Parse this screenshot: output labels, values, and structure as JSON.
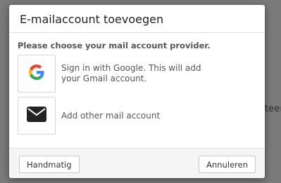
{
  "backdrop": {
    "partial_text": "teer"
  },
  "dialog": {
    "title": "E-mailaccount toevoegen",
    "prompt": "Please choose your mail account provider.",
    "options": [
      {
        "icon": "google-icon",
        "label": "Sign in with Google. This will add your Gmail account."
      },
      {
        "icon": "envelope-icon",
        "label": "Add other mail account"
      }
    ],
    "footer": {
      "manual_label": "Handmatig",
      "cancel_label": "Annuleren"
    }
  },
  "colors": {
    "backdrop": "#7a7a7a",
    "google_blue": "#4285F4",
    "google_red": "#EA4335",
    "google_yellow": "#FBBC05",
    "google_green": "#34A853",
    "envelope": "#222222"
  }
}
